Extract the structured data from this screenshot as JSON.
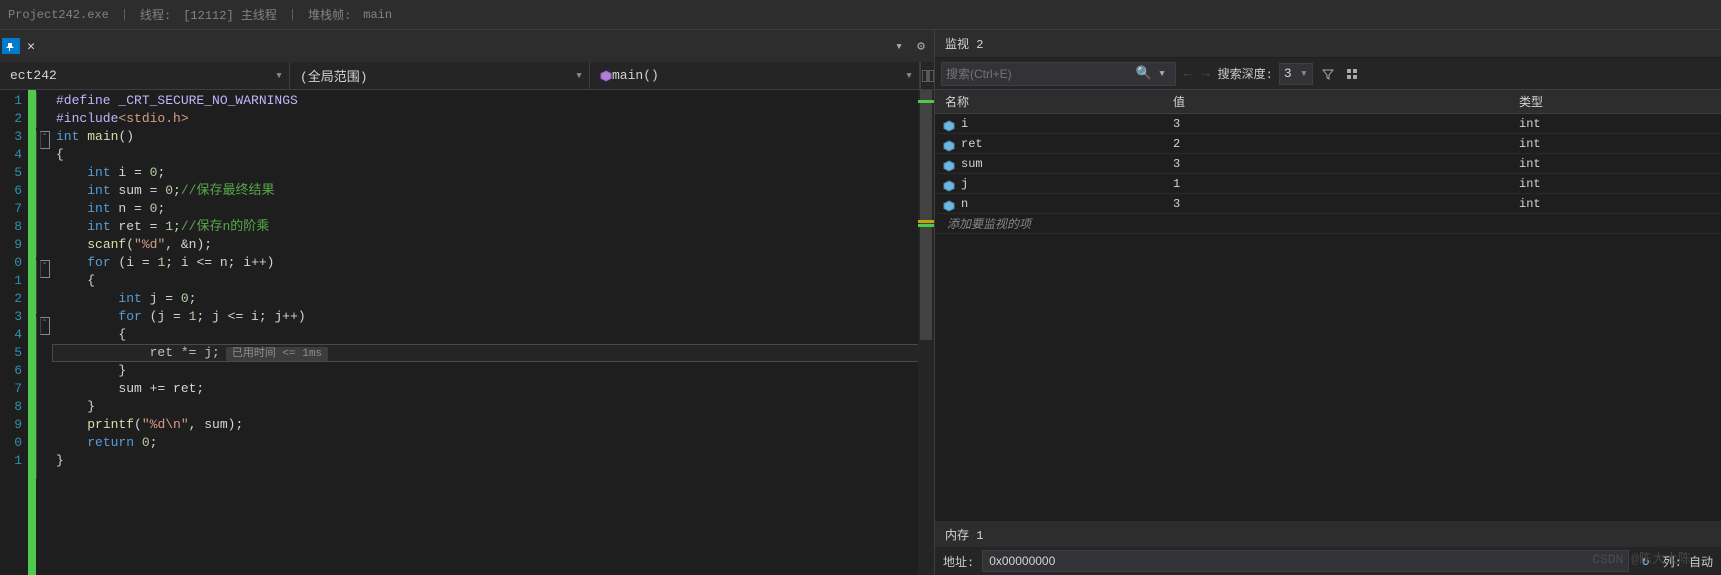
{
  "topbar": {
    "process_trunc": "Project242.exe",
    "thread_label": "线程:",
    "thread_value": "[12112] 主线程",
    "frame_label": "堆栈帧:",
    "frame_value": "main"
  },
  "nav": {
    "file_name": "ect242",
    "scope_label": "(全局范围)",
    "func_label": "main()"
  },
  "code_lines": [
    {
      "n": "1",
      "raw": [
        {
          "c": "macro",
          "t": "#define _CRT_SECURE_NO_WARNINGS"
        }
      ]
    },
    {
      "n": "2",
      "raw": [
        {
          "c": "macro",
          "t": "#include"
        },
        {
          "c": "str",
          "t": "<stdio.h>"
        }
      ]
    },
    {
      "n": "3",
      "fold": "-",
      "raw": [
        {
          "c": "kw",
          "t": "int"
        },
        {
          "c": "",
          "t": " "
        },
        {
          "c": "fn",
          "t": "main"
        },
        {
          "c": "",
          "t": "()"
        }
      ]
    },
    {
      "n": "4",
      "raw": [
        {
          "c": "",
          "t": "{"
        }
      ]
    },
    {
      "n": "5",
      "raw": [
        {
          "c": "",
          "t": "    "
        },
        {
          "c": "kw",
          "t": "int"
        },
        {
          "c": "",
          "t": " i = "
        },
        {
          "c": "num",
          "t": "0"
        },
        {
          "c": "",
          "t": ";"
        }
      ]
    },
    {
      "n": "6",
      "raw": [
        {
          "c": "",
          "t": "    "
        },
        {
          "c": "kw",
          "t": "int"
        },
        {
          "c": "",
          "t": " sum = "
        },
        {
          "c": "num",
          "t": "0"
        },
        {
          "c": "",
          "t": ";"
        },
        {
          "c": "comment",
          "t": "//保存最终结果"
        }
      ]
    },
    {
      "n": "7",
      "raw": [
        {
          "c": "",
          "t": "    "
        },
        {
          "c": "kw",
          "t": "int"
        },
        {
          "c": "",
          "t": " n = "
        },
        {
          "c": "num",
          "t": "0"
        },
        {
          "c": "",
          "t": ";"
        }
      ]
    },
    {
      "n": "8",
      "raw": [
        {
          "c": "",
          "t": "    "
        },
        {
          "c": "kw",
          "t": "int"
        },
        {
          "c": "",
          "t": " ret = "
        },
        {
          "c": "num",
          "t": "1"
        },
        {
          "c": "",
          "t": ";"
        },
        {
          "c": "comment",
          "t": "//保存n的阶乘"
        }
      ]
    },
    {
      "n": "9",
      "raw": [
        {
          "c": "",
          "t": "    "
        },
        {
          "c": "fn",
          "t": "scanf"
        },
        {
          "c": "",
          "t": "("
        },
        {
          "c": "str",
          "t": "\"%d\""
        },
        {
          "c": "",
          "t": ", &n);"
        }
      ]
    },
    {
      "n": "0",
      "fold": "-",
      "raw": [
        {
          "c": "",
          "t": "    "
        },
        {
          "c": "kw",
          "t": "for"
        },
        {
          "c": "",
          "t": " (i = "
        },
        {
          "c": "num",
          "t": "1"
        },
        {
          "c": "",
          "t": "; i <= n; i++)"
        }
      ]
    },
    {
      "n": "1",
      "raw": [
        {
          "c": "",
          "t": "    {"
        }
      ]
    },
    {
      "n": "2",
      "raw": [
        {
          "c": "",
          "t": "        "
        },
        {
          "c": "kw",
          "t": "int"
        },
        {
          "c": "",
          "t": " j = "
        },
        {
          "c": "num",
          "t": "0"
        },
        {
          "c": "",
          "t": ";"
        }
      ]
    },
    {
      "n": "3",
      "fold": "-",
      "raw": [
        {
          "c": "",
          "t": "        "
        },
        {
          "c": "kw",
          "t": "for"
        },
        {
          "c": "",
          "t": " (j = "
        },
        {
          "c": "num",
          "t": "1"
        },
        {
          "c": "",
          "t": "; j <= i; j++)"
        }
      ]
    },
    {
      "n": "4",
      "raw": [
        {
          "c": "",
          "t": "        {"
        }
      ]
    },
    {
      "n": "5",
      "hl": true,
      "raw": [
        {
          "c": "",
          "t": "            ret *= j;"
        }
      ],
      "elapsed": "已用时间 <= 1ms"
    },
    {
      "n": "6",
      "raw": [
        {
          "c": "",
          "t": "        }"
        }
      ]
    },
    {
      "n": "7",
      "raw": [
        {
          "c": "",
          "t": "        sum += ret;"
        }
      ]
    },
    {
      "n": "8",
      "raw": [
        {
          "c": "",
          "t": "    }"
        }
      ]
    },
    {
      "n": "9",
      "raw": [
        {
          "c": "",
          "t": "    "
        },
        {
          "c": "fn",
          "t": "printf"
        },
        {
          "c": "",
          "t": "("
        },
        {
          "c": "str",
          "t": "\"%d\\n\""
        },
        {
          "c": "",
          "t": ", sum);"
        }
      ]
    },
    {
      "n": "0",
      "raw": [
        {
          "c": "",
          "t": "    "
        },
        {
          "c": "kw",
          "t": "return"
        },
        {
          "c": "",
          "t": " "
        },
        {
          "c": "num",
          "t": "0"
        },
        {
          "c": "",
          "t": ";"
        }
      ]
    },
    {
      "n": "1",
      "raw": [
        {
          "c": "",
          "t": "}"
        }
      ]
    }
  ],
  "watch": {
    "panel_title": "监视 2",
    "search_placeholder": "搜索(Ctrl+E)",
    "depth_label": "搜索深度:",
    "depth_value": "3",
    "cols": {
      "name": "名称",
      "value": "值",
      "type": "类型"
    },
    "rows": [
      {
        "name": "i",
        "value": "3",
        "type": "int"
      },
      {
        "name": "ret",
        "value": "2",
        "type": "int"
      },
      {
        "name": "sum",
        "value": "3",
        "type": "int"
      },
      {
        "name": "j",
        "value": "1",
        "type": "int"
      },
      {
        "name": "n",
        "value": "3",
        "type": "int"
      }
    ],
    "add_text": "添加要监视的项"
  },
  "memory": {
    "title": "内存 1",
    "addr_label": "地址:",
    "addr_value": "0x00000000",
    "cols_label": "列:",
    "refresh": "自动"
  },
  "watermark": "CSDN @陈大大陈"
}
